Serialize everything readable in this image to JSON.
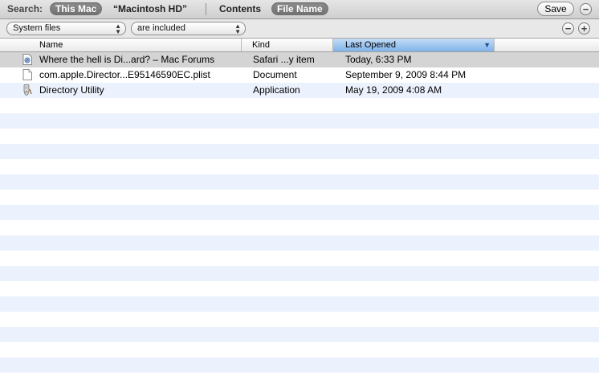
{
  "search": {
    "label": "Search:",
    "scopes": [
      "This Mac",
      "“Macintosh HD”"
    ],
    "selected_scope": "This Mac",
    "targets": [
      "Contents",
      "File Name"
    ],
    "selected_target": "File Name",
    "save_label": "Save",
    "remove_symbol": "−"
  },
  "criteria": {
    "attribute": "System files",
    "operator": "are included",
    "remove_symbol": "−",
    "add_symbol": "+"
  },
  "columns": {
    "name": "Name",
    "kind": "Kind",
    "last_opened": "Last Opened",
    "sort_indicator": "▼"
  },
  "files": [
    {
      "name": "Where the hell is Di...ard? – Mac Forums",
      "kind": "Safari ...y item",
      "last_opened": "Today, 6:33 PM",
      "icon": "safari-webloc-icon",
      "selected": true
    },
    {
      "name": "com.apple.Director...E95146590EC.plist",
      "kind": "Document",
      "last_opened": "September 9, 2009 8:44 PM",
      "icon": "document-icon",
      "selected": false
    },
    {
      "name": "Directory Utility",
      "kind": "Application",
      "last_opened": "May 19, 2009 4:08 AM",
      "icon": "directory-utility-icon",
      "selected": false
    }
  ],
  "colors": {
    "stripe": "#ecf2fd",
    "selection": "#d4d4d4",
    "sorted_header": "#7fb3ea"
  }
}
